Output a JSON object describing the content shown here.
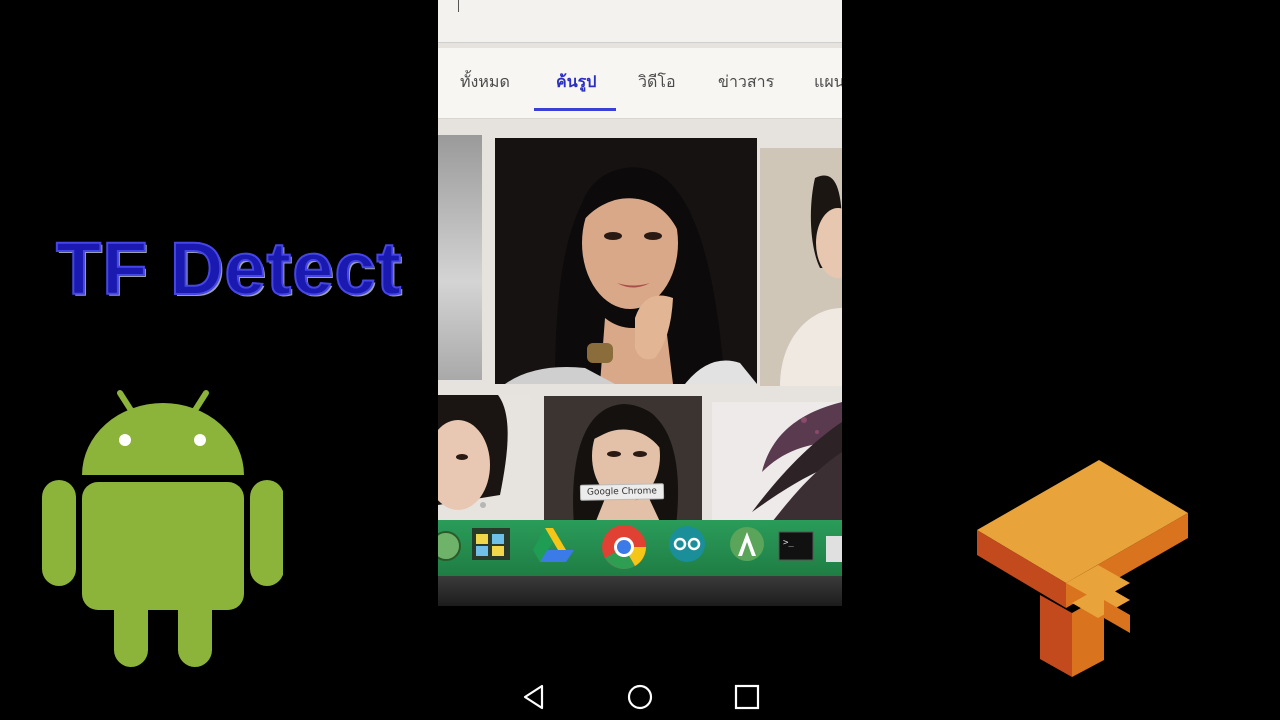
{
  "overlay": {
    "title": "TF Detect"
  },
  "logos": {
    "android": "android-logo",
    "tensorflow": "tensorflow-logo"
  },
  "camera_view": {
    "tabs": [
      {
        "label": "ทั้งหมด",
        "active": false
      },
      {
        "label": "ค้นรูป",
        "active": true
      },
      {
        "label": "วิดีโอ",
        "active": false
      },
      {
        "label": "ข่าวสาร",
        "active": false
      },
      {
        "label": "แผน",
        "active": false
      }
    ],
    "tooltip": "Google Chrome",
    "dock_icons": [
      "app-icon",
      "stickies-icon",
      "google-drive-icon",
      "chrome-icon",
      "arduino-icon",
      "android-studio-icon",
      "terminal-icon",
      "file-icon"
    ]
  },
  "navigation": {
    "back": "back-icon",
    "home": "home-icon",
    "recents": "recents-icon"
  },
  "colors": {
    "title_fill": "#1a1ab0",
    "title_outline": "#4646e8",
    "android_green": "#8cb33a",
    "tf_orange": "#e8a33a",
    "tab_active": "#2b2fc4"
  }
}
